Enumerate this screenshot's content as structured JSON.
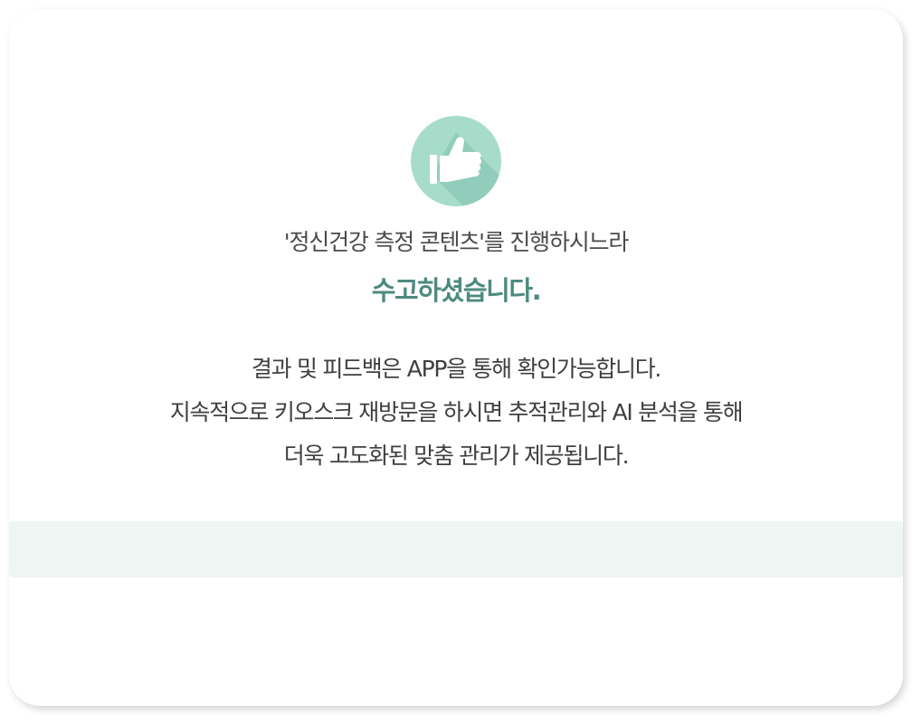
{
  "icon": {
    "name": "thumbs-up-icon",
    "circle_color": "#a7dccb",
    "hand_color": "#ffffff"
  },
  "message": {
    "lead": "'정신건강 측정 콘텐츠'를 진행하시느라",
    "thanks": "수고하셨습니다."
  },
  "info": {
    "lines": [
      "결과 및 피드백은 APP을 통해 확인가능합니다.",
      "지속적으로 키오스크 재방문을 하시면 추적관리와 AI 분석을 통해",
      "더욱 고도화된 맞춤 관리가 제공됩니다."
    ]
  },
  "colors": {
    "accent": "#4e8a80",
    "band": "#eef6f3",
    "text": "#3f3f3f"
  }
}
